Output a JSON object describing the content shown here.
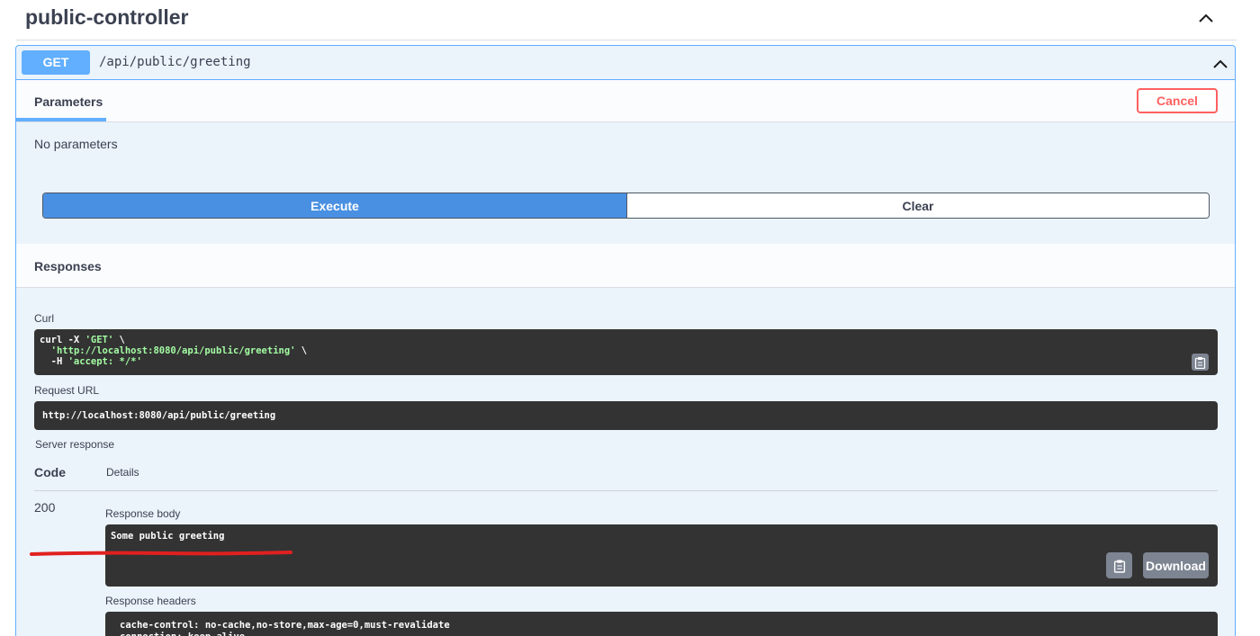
{
  "tag": {
    "title": "public-controller"
  },
  "operation": {
    "method": "GET",
    "path": "/api/public/greeting"
  },
  "tabs": {
    "parameters": "Parameters"
  },
  "buttons": {
    "cancel": "Cancel",
    "execute": "Execute",
    "clear": "Clear",
    "download": "Download"
  },
  "parameters": {
    "empty_text": "No parameters"
  },
  "responses": {
    "title": "Responses",
    "curl_label": "Curl",
    "curl": {
      "line1": "curl -X ",
      "method_str": "'GET'",
      "line1_tail": " \\",
      "url_str": "'http://localhost:8080/api/public/greeting'",
      "line2_tail": " \\",
      "line3_pre": "  -H ",
      "accept_str": "'accept: */*'"
    },
    "request_url_label": "Request URL",
    "request_url": "http://localhost:8080/api/public/greeting",
    "server_response_label": "Server response",
    "col_code": "Code",
    "col_details": "Details",
    "status_code": "200",
    "body_label": "Response body",
    "body": "Some public greeting",
    "headers_label": "Response headers",
    "headers": "cache-control: no-cache,no-store,max-age=0,must-revalidate\nconnection: keep-alive"
  },
  "colors": {
    "get_accent": "#61affe",
    "execute": "#4990e2",
    "cancel": "#ff6060",
    "annotation": "#e02020"
  }
}
